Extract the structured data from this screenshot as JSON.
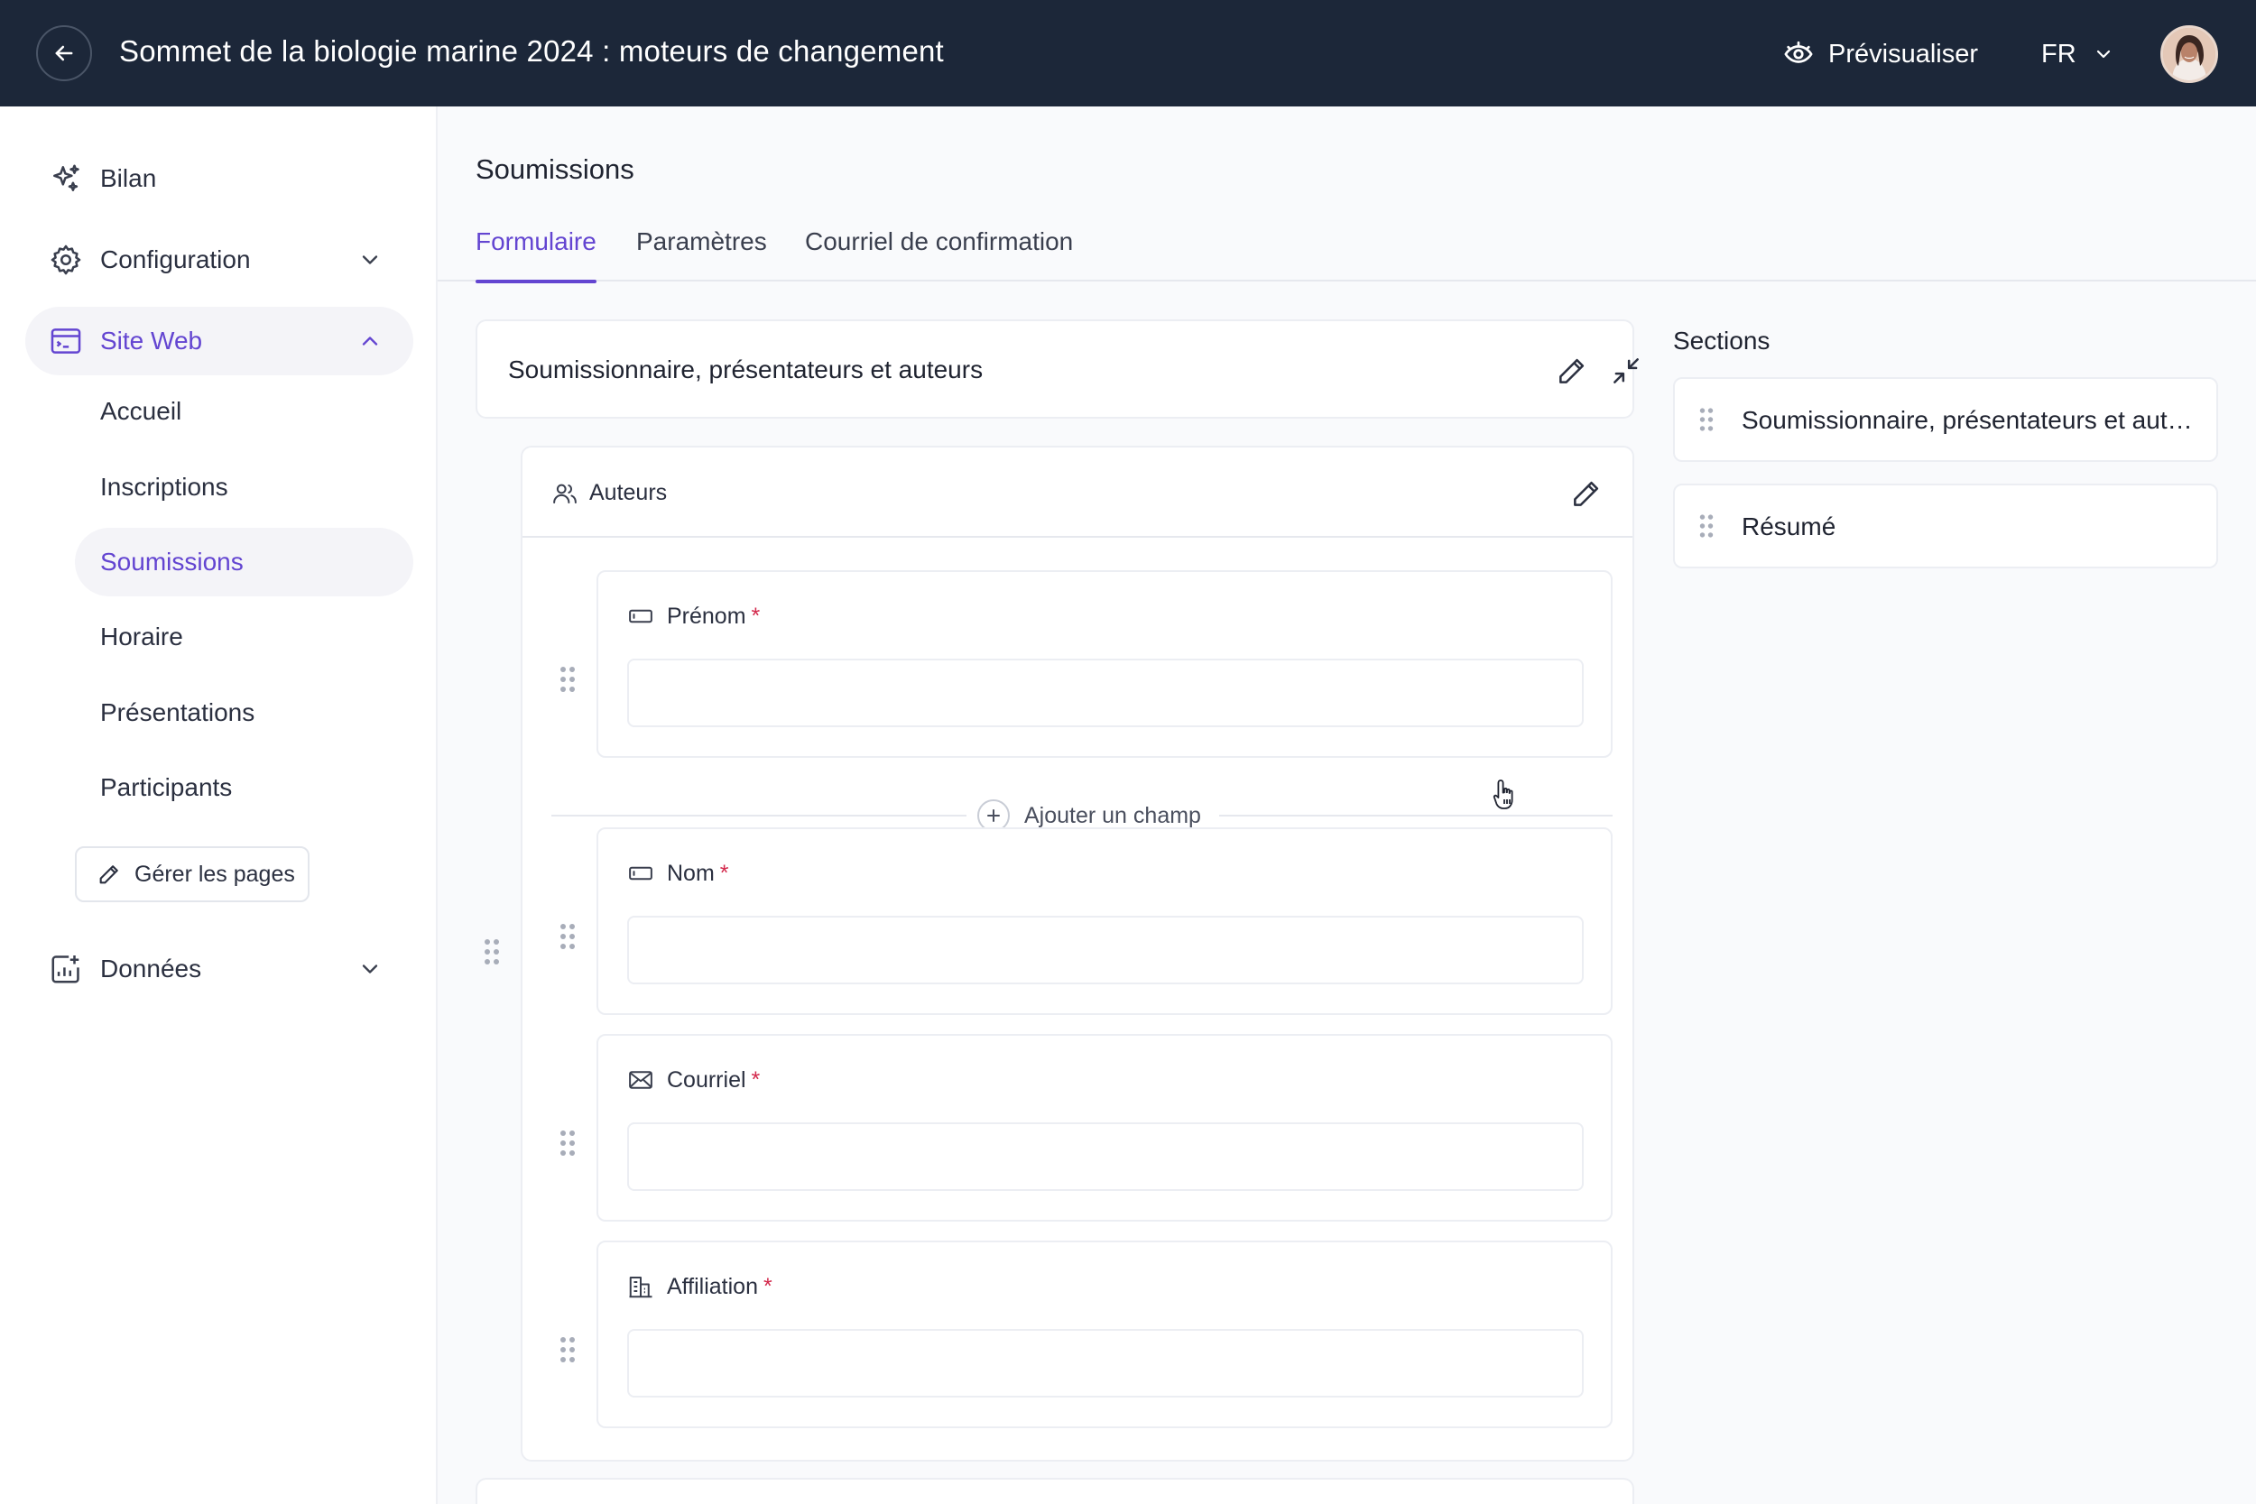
{
  "header": {
    "back_icon": "arrow-left-icon",
    "title": "Sommet de la biologie marine 2024 : moteurs de changement",
    "preview_label": "Prévisualiser",
    "preview_icon": "eye-icon",
    "language": "FR",
    "colors": {
      "background": "#1c2739",
      "text": "#ffffff"
    }
  },
  "sidebar": {
    "items": [
      {
        "label": "Bilan",
        "icon": "sparkles-icon"
      },
      {
        "label": "Configuration",
        "icon": "gear-icon",
        "expanded": false
      },
      {
        "label": "Site Web",
        "icon": "browser-window-icon",
        "expanded": true,
        "active": true
      },
      {
        "label": "Données",
        "icon": "data-chart-icon",
        "expanded": false
      }
    ],
    "site_pages": [
      {
        "label": "Accueil"
      },
      {
        "label": "Inscriptions"
      },
      {
        "label": "Soumissions",
        "active": true
      },
      {
        "label": "Horaire"
      },
      {
        "label": "Présentations"
      },
      {
        "label": "Participants"
      }
    ],
    "manage_pages_label": "Gérer les pages",
    "accent_color": "#6345d1"
  },
  "main": {
    "page_title": "Soumissions",
    "tabs": [
      {
        "label": "Formulaire",
        "active": true
      },
      {
        "label": "Paramètres",
        "active": false
      },
      {
        "label": "Courriel de confirmation",
        "active": false
      }
    ],
    "section": {
      "title": "Soumissionnaire, présentateurs et auteurs"
    },
    "group": {
      "title": "Auteurs",
      "icon": "users-icon",
      "fields": [
        {
          "label": "Prénom",
          "required": true,
          "icon": "text-field-icon",
          "value": ""
        },
        {
          "label": "Nom",
          "required": true,
          "icon": "text-field-icon",
          "value": ""
        },
        {
          "label": "Courriel",
          "required": true,
          "icon": "envelope-icon",
          "value": ""
        },
        {
          "label": "Affiliation",
          "required": true,
          "icon": "building-icon",
          "value": ""
        }
      ],
      "add_field_label": "Ajouter un champ"
    }
  },
  "sections_panel": {
    "title": "Sections",
    "items": [
      {
        "label": "Soumissionnaire, présentateurs et auteurs"
      },
      {
        "label": "Résumé"
      }
    ]
  },
  "required_marker": "*"
}
